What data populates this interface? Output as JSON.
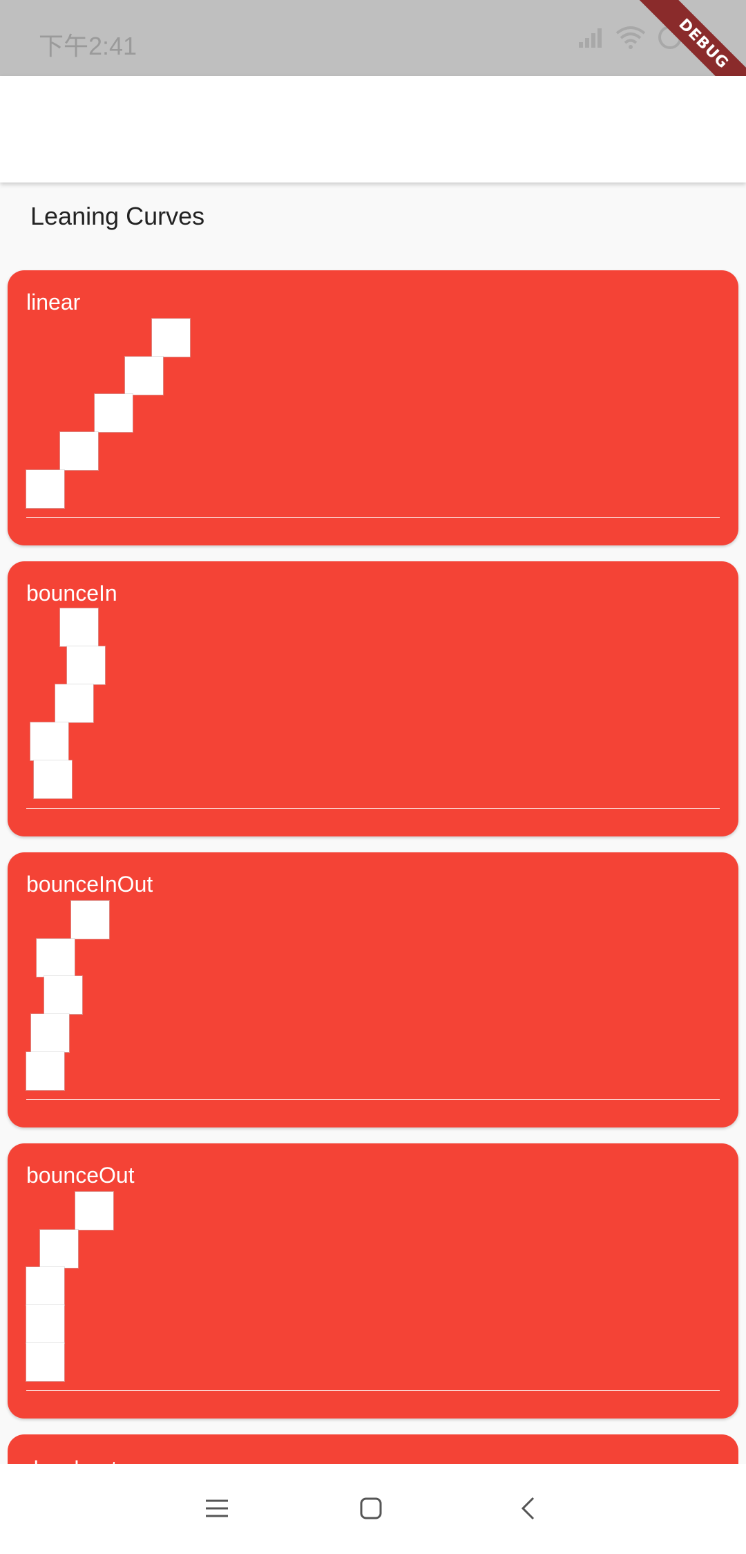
{
  "status_bar": {
    "time": "下午2:41",
    "icons": [
      "signal-icon",
      "wifi-icon",
      "alarm-icon"
    ]
  },
  "debug_banner": "DEBUG",
  "page": {
    "title": "Leaning Curves"
  },
  "cards": [
    {
      "label": "linear"
    },
    {
      "label": "bounceIn"
    },
    {
      "label": "bounceInOut"
    },
    {
      "label": "bounceOut"
    },
    {
      "label": "decelerate"
    }
  ],
  "nav_bar": {
    "icons": [
      "menu-icon",
      "home-icon",
      "back-icon"
    ]
  },
  "colors": {
    "card": "#f44336",
    "box": "#ffffff",
    "status_bar": "#bfbfbf"
  }
}
